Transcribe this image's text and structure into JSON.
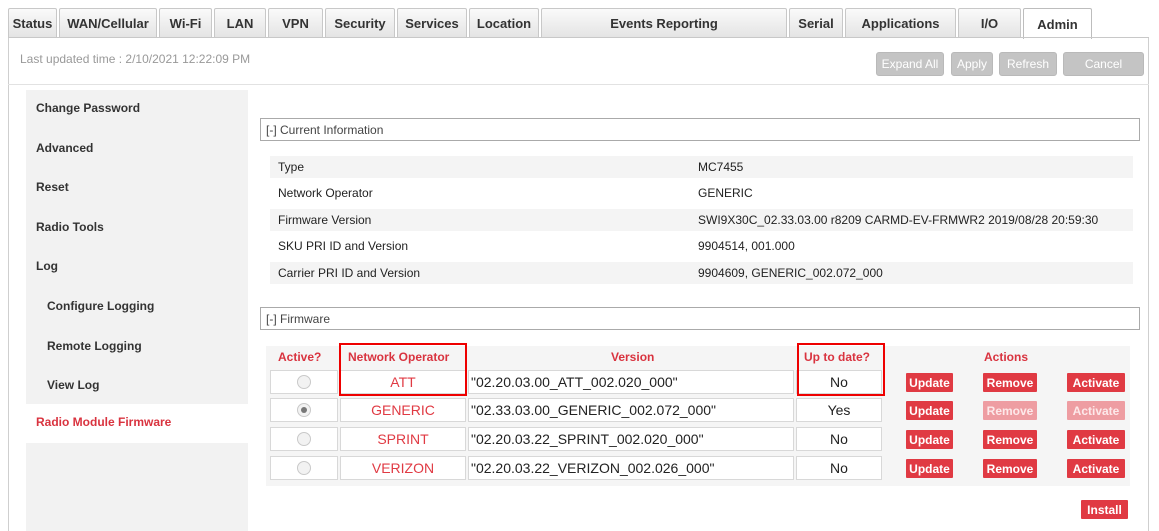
{
  "tabs": [
    {
      "label": "Status"
    },
    {
      "label": "WAN/Cellular"
    },
    {
      "label": "Wi-Fi"
    },
    {
      "label": "LAN"
    },
    {
      "label": "VPN"
    },
    {
      "label": "Security"
    },
    {
      "label": "Services"
    },
    {
      "label": "Location"
    },
    {
      "label": "Events Reporting"
    },
    {
      "label": "Serial"
    },
    {
      "label": "Applications"
    },
    {
      "label": "I/O"
    },
    {
      "label": "Admin"
    }
  ],
  "header": {
    "last_updated_label": "Last updated time : ",
    "last_updated_value": "2/10/2021 12:22:09 PM",
    "buttons": [
      "Expand All",
      "Apply",
      "Refresh",
      "Cancel"
    ]
  },
  "sidebar": {
    "items": [
      {
        "label": "Change Password"
      },
      {
        "label": "Advanced"
      },
      {
        "label": "Reset"
      },
      {
        "label": "Radio Tools"
      },
      {
        "label": "Log"
      },
      {
        "label": "Configure Logging"
      },
      {
        "label": "Remote Logging"
      },
      {
        "label": "View Log"
      },
      {
        "label": "Radio Module Firmware"
      }
    ],
    "active": "Radio Module Firmware"
  },
  "current_info": {
    "title": "[-] Current Information",
    "rows": [
      {
        "key": "Type",
        "value": "MC7455"
      },
      {
        "key": "Network Operator",
        "value": "GENERIC"
      },
      {
        "key": "Firmware Version",
        "value": "SWI9X30C_02.33.03.00 r8209 CARMD-EV-FRMWR2 2019/08/28 20:59:30"
      },
      {
        "key": "SKU PRI ID and Version",
        "value": "9904514, 001.000"
      },
      {
        "key": "Carrier PRI ID and Version",
        "value": "9904609, GENERIC_002.072_000"
      }
    ]
  },
  "firmware": {
    "title": "[-] Firmware",
    "headers": {
      "active": "Active?",
      "operator": "Network Operator",
      "version": "Version",
      "uptodate": "Up to date?",
      "actions": "Actions"
    },
    "rows": [
      {
        "active": false,
        "operator": "ATT",
        "version": "\"02.20.03.00_ATT_002.020_000\"",
        "uptodate": "No",
        "remove_enabled": true,
        "activate_enabled": true
      },
      {
        "active": true,
        "operator": "GENERIC",
        "version": "\"02.33.03.00_GENERIC_002.072_000\"",
        "uptodate": "Yes",
        "remove_enabled": false,
        "activate_enabled": false
      },
      {
        "active": false,
        "operator": "SPRINT",
        "version": "\"02.20.03.22_SPRINT_002.020_000\"",
        "uptodate": "No",
        "remove_enabled": true,
        "activate_enabled": true
      },
      {
        "active": false,
        "operator": "VERIZON",
        "version": "\"02.20.03.22_VERIZON_002.026_000\"",
        "uptodate": "No",
        "remove_enabled": true,
        "activate_enabled": true
      }
    ],
    "action_labels": {
      "update": "Update",
      "remove": "Remove",
      "activate": "Activate"
    },
    "install_label": "Install"
  },
  "colors": {
    "accent": "#e03a43",
    "highlight": "#ee0000"
  }
}
